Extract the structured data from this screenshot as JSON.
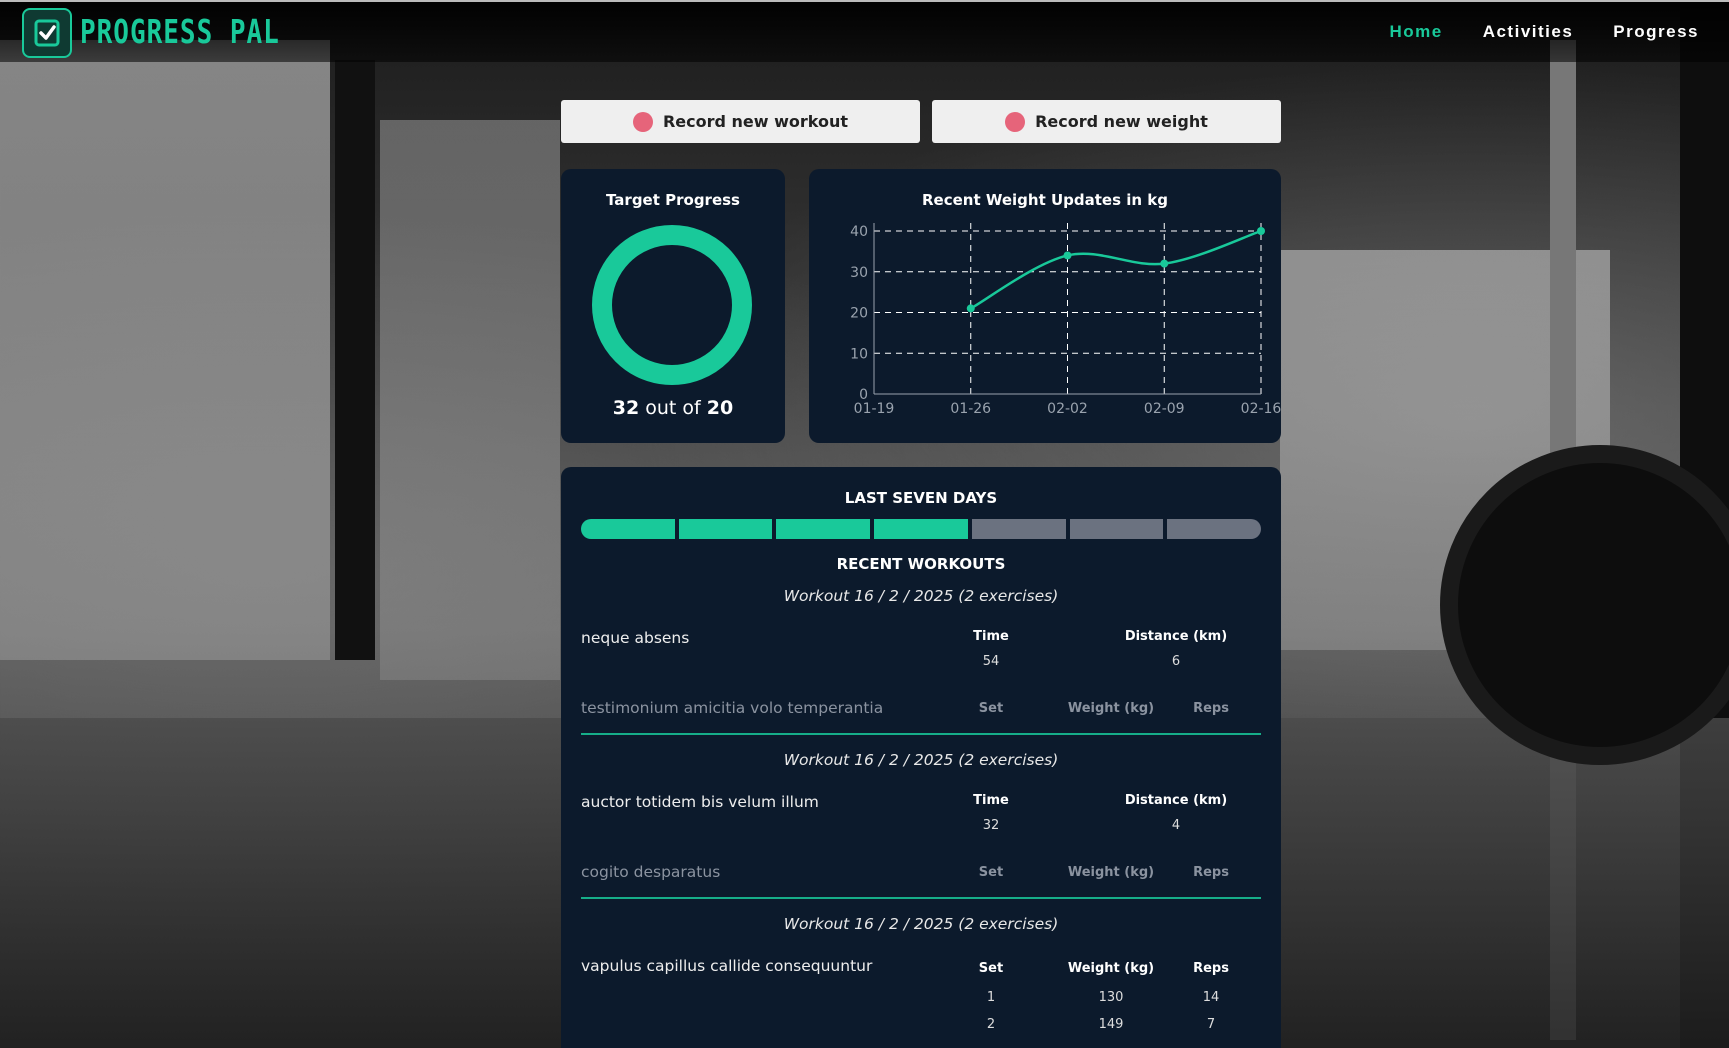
{
  "app": {
    "name": "PROGRESS PAL"
  },
  "nav": [
    {
      "label": "Home",
      "active": true
    },
    {
      "label": "Activities",
      "active": false
    },
    {
      "label": "Progress",
      "active": false
    }
  ],
  "actions": {
    "record_workout": "Record new workout",
    "record_weight": "Record new weight"
  },
  "target": {
    "title": "Target Progress",
    "current": "32",
    "middle": "out of",
    "goal": "20",
    "accent": "#19c99a"
  },
  "weight_chart": {
    "title": "Recent Weight Updates in kg"
  },
  "chart_data": {
    "type": "line",
    "title": "Recent Weight Updates in kg",
    "x": [
      "01-26",
      "02-02",
      "02-09",
      "02-16"
    ],
    "values": [
      21,
      34,
      32,
      40
    ],
    "x_ticks": [
      "01-19",
      "01-26",
      "02-02",
      "02-09",
      "02-16"
    ],
    "y_ticks": [
      "0",
      "10",
      "20",
      "30",
      "40"
    ],
    "ylim": [
      0,
      40
    ],
    "grid": true,
    "color": "#19c99a"
  },
  "last_seven": {
    "title": "LAST SEVEN DAYS",
    "days": [
      true,
      true,
      true,
      true,
      false,
      false,
      false
    ]
  },
  "recent": {
    "title": "RECENT WORKOUTS",
    "workouts": [
      {
        "header": "Workout 16 / 2 / 2025 (2 exercises)",
        "exercises": [
          {
            "name": "neque absens",
            "col1": "Time",
            "col2": "Distance (km)",
            "val1": "54",
            "val2": "6"
          },
          {
            "name": "testimonium amicitia volo temperantia",
            "col1": "Set",
            "col2": "Weight (kg)",
            "col3": "Reps"
          }
        ]
      },
      {
        "header": "Workout 16 / 2 / 2025 (2 exercises)",
        "exercises": [
          {
            "name": "auctor totidem bis velum illum",
            "col1": "Time",
            "col2": "Distance (km)",
            "val1": "32",
            "val2": "4"
          },
          {
            "name": "cogito desparatus",
            "col1": "Set",
            "col2": "Weight (kg)",
            "col3": "Reps"
          }
        ]
      },
      {
        "header": "Workout 16 / 2 / 2025 (2 exercises)",
        "exercises": [
          {
            "name": "vapulus capillus callide consequuntur",
            "col1": "Set",
            "col2": "Weight (kg)",
            "col3": "Reps",
            "rows": [
              [
                "1",
                "130",
                "14"
              ],
              [
                "2",
                "149",
                "7"
              ]
            ]
          }
        ]
      }
    ]
  }
}
